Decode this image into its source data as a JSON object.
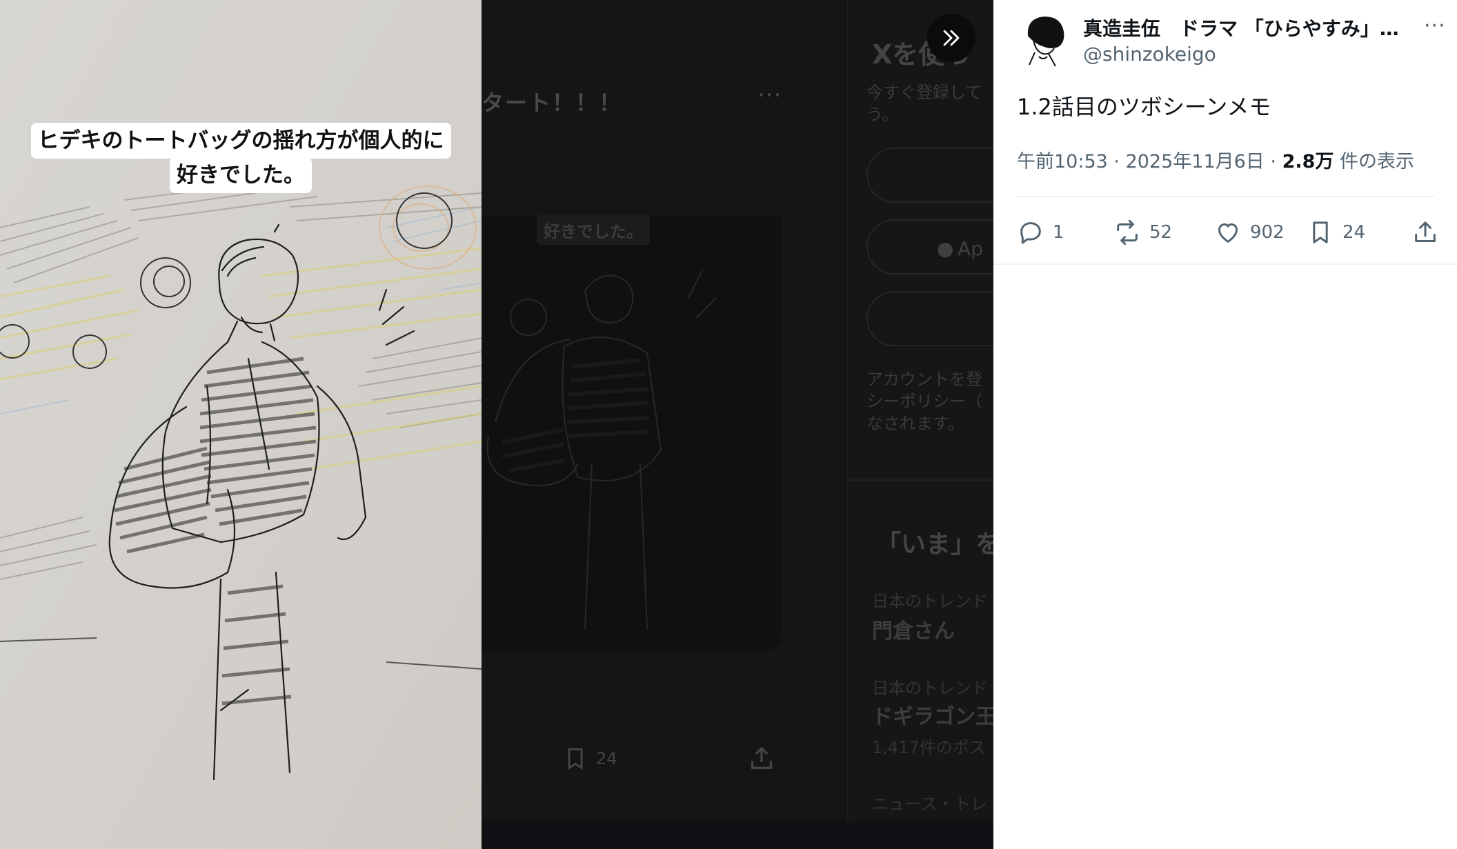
{
  "viewer": {
    "caption_line1": "ヒデキのトートバッグの揺れ方が個人的に",
    "caption_line2": "好きでした。"
  },
  "background_page": {
    "feed_title": "タート！！！",
    "feed_more": "···",
    "media_caption": "好きでした。",
    "bookmark_count": "24",
    "sidebar": {
      "heading": "Xを使っ",
      "intro": [
        "今すぐ登録して",
        "う。"
      ],
      "apple_button": "Ap",
      "legal": [
        "アカウントを登",
        "シーポリシー（",
        "なされます。"
      ],
      "trends_heading": "「いま」を",
      "trends": [
        {
          "category": "日本のトレンド",
          "name": "門倉さん",
          "posts": ""
        },
        {
          "category": "日本のトレンド",
          "name": "ドギラゴン王",
          "posts": "1,417件のポス"
        },
        {
          "category": "ニュース・トレ",
          "name": "",
          "posts": ""
        }
      ]
    }
  },
  "collapse_button": {
    "icon": "double-chevron-right-icon"
  },
  "tweet": {
    "display_name": "真造圭伍　ドラマ 「ひらやすみ」…",
    "handle": "@shinzokeigo",
    "more": "···",
    "text": "1.2話目のツボシーンメモ",
    "time": "午前10:53",
    "date": "2025年11月6日",
    "views_value": "2.8万",
    "views_label": "件の表示",
    "separator": " · ",
    "actions": {
      "replies": "1",
      "reposts": "52",
      "likes": "902",
      "bookmarks": "24"
    }
  },
  "colors": {
    "text_primary": "#0f1419",
    "text_secondary": "#536471",
    "divider": "#eff3f4",
    "paper": "#d6d3cf"
  }
}
